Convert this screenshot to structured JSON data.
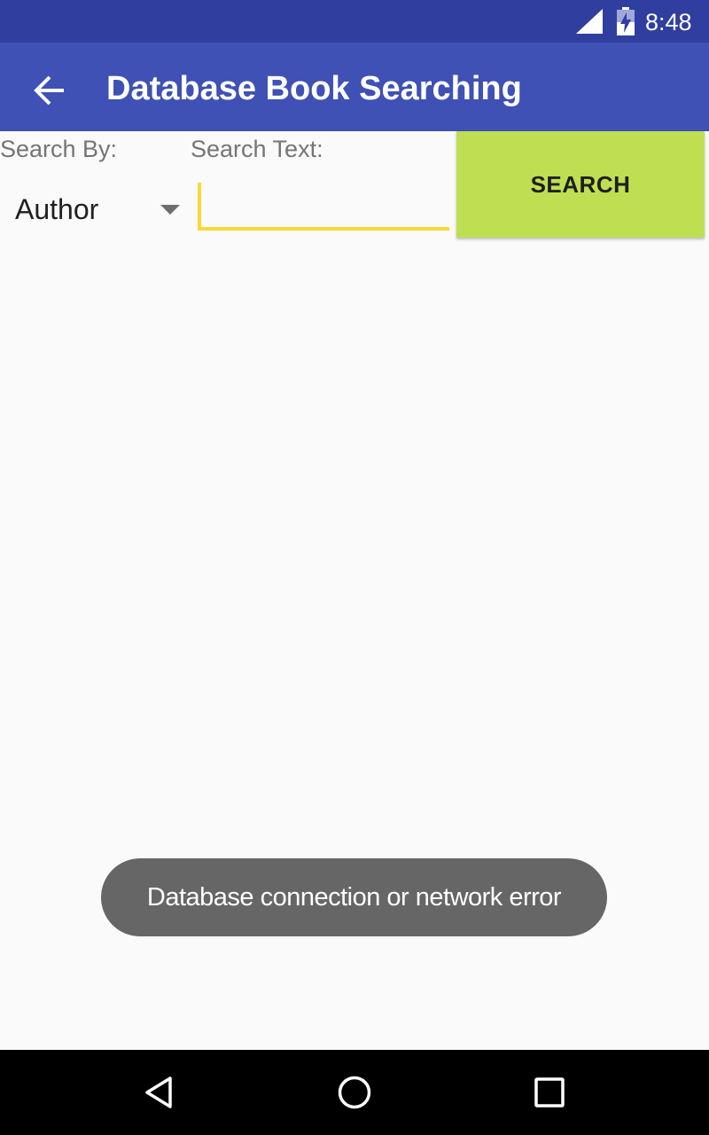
{
  "status_bar": {
    "time": "8:48",
    "icons": [
      "cellular-signal-icon",
      "battery-charging-icon"
    ]
  },
  "app_bar": {
    "title": "Database Book Searching",
    "nav_icon": "back-arrow-icon"
  },
  "search_form": {
    "search_by_label": "Search By:",
    "search_text_label": "Search Text:",
    "search_by_selected": "Author",
    "search_text_value": "",
    "search_button_label": "SEARCH"
  },
  "toast": {
    "message": "Database connection or network error"
  },
  "nav_bar": {
    "buttons": [
      "back-triangle-icon",
      "home-circle-icon",
      "recents-square-icon"
    ]
  },
  "colors": {
    "status_bar": "#303f9f",
    "app_bar": "#3f51b5",
    "search_button": "#bfdf52",
    "input_underline": "#fdd835",
    "toast_background": "#666666",
    "background": "#fafafa"
  }
}
